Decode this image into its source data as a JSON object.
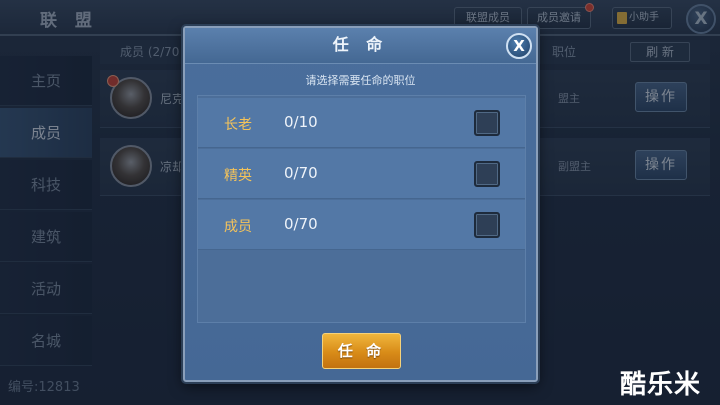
{
  "window": {
    "title": "联 盟",
    "tabs": {
      "members": "联盟成员",
      "invite": "成员邀请",
      "helper": "小助手"
    },
    "close": "X"
  },
  "sidebar": {
    "items": [
      {
        "label": "主页"
      },
      {
        "label": "成员"
      },
      {
        "label": "科技"
      },
      {
        "label": "建筑"
      },
      {
        "label": "活动"
      },
      {
        "label": "名城"
      }
    ],
    "active": "成员",
    "guild_id": "编号:12813"
  },
  "member_list": {
    "count_label": "成员 (2/70",
    "post_label": "职位",
    "refresh": "刷 新",
    "rows": [
      {
        "name": "尼克",
        "rank": "盟主",
        "action": "操作",
        "leader": true
      },
      {
        "name": "凉却",
        "rank": "副盟主",
        "action": "操作",
        "leader": false
      }
    ]
  },
  "modal": {
    "title": "任 命",
    "close": "X",
    "prompt": "请选择需要任命的职位",
    "positions": [
      {
        "name": "长老",
        "count": "0/10",
        "checked": false
      },
      {
        "name": "精英",
        "count": "0/70",
        "checked": false
      },
      {
        "name": "成员",
        "count": "0/70",
        "checked": false
      }
    ],
    "confirm": "任 命"
  },
  "watermark": "酷乐米",
  "colors": {
    "modal_bg": "#4a6e9c",
    "position_name": "#f4c35a",
    "confirm_button": "#e0981f"
  }
}
